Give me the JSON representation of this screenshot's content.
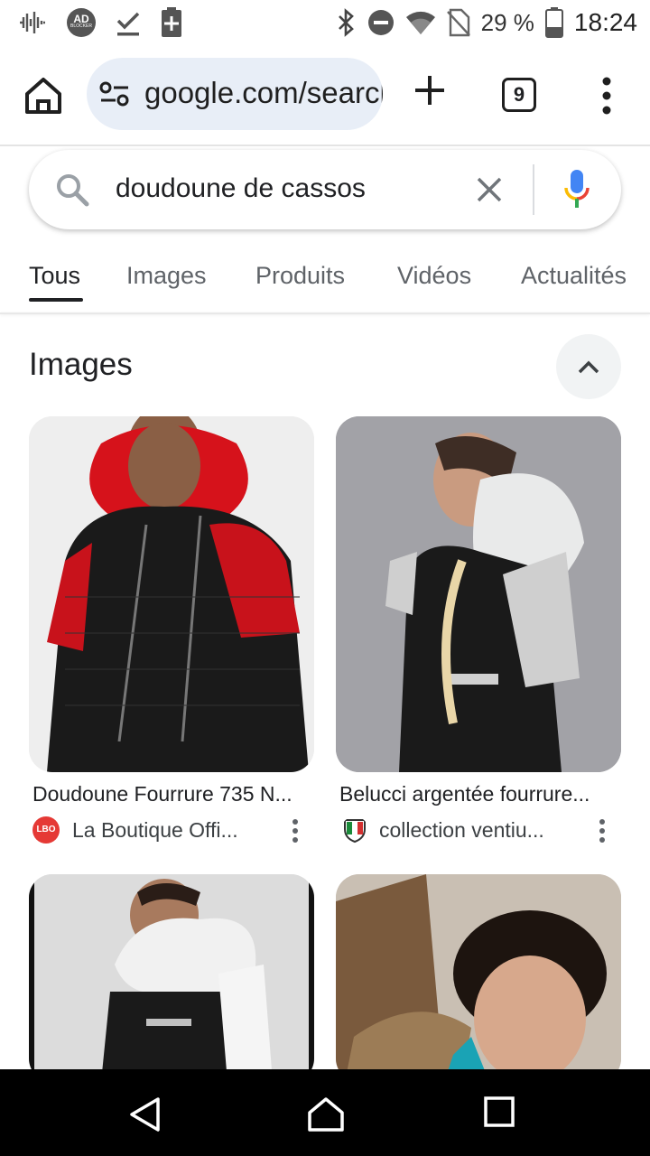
{
  "status_bar": {
    "battery": "29 %",
    "time": "18:24",
    "left_icons": [
      "audio-wave-icon",
      "ad-blocker-icon",
      "download-done-icon",
      "battery-saver-icon"
    ],
    "right_icons": [
      "bluetooth-icon",
      "do-not-disturb-icon",
      "wifi-icon",
      "no-sim-icon",
      "battery-icon"
    ],
    "ad_blocker_badge": "AD",
    "ad_blocker_sub": "BLOCKER"
  },
  "toolbar": {
    "url": "google.com/search",
    "tab_count": "9"
  },
  "search": {
    "query": "doudoune de cassos"
  },
  "tabs": [
    "Tous",
    "Images",
    "Produits",
    "Vidéos",
    "Actualités"
  ],
  "images_section": {
    "title": "Images",
    "results": [
      {
        "title": "Doudoune Fourrure 735 N...",
        "source": "La Boutique Offi...",
        "logo_text": "LBO"
      },
      {
        "title": "Belucci argentée fourrure...",
        "source": "collection ventiu..."
      }
    ]
  },
  "colors": {
    "accent_blue": "#4285f4",
    "google_red": "#ea4335",
    "google_yellow": "#fbbc05",
    "google_green": "#34a853",
    "url_pill": "#e8eef7"
  }
}
